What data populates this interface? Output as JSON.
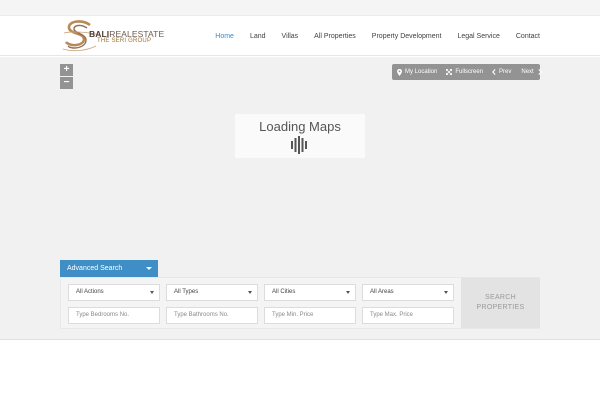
{
  "logo": {
    "brand_prefix": "BALI",
    "brand_suffix": "REALESTATE",
    "tagline": "THE SERI GROUP"
  },
  "nav": {
    "items": [
      {
        "label": "Home",
        "active": true
      },
      {
        "label": "Land",
        "active": false
      },
      {
        "label": "Villas",
        "active": false
      },
      {
        "label": "All Properties",
        "active": false
      },
      {
        "label": "Property Development",
        "active": false
      },
      {
        "label": "Legal Service",
        "active": false
      },
      {
        "label": "Contact",
        "active": false
      }
    ]
  },
  "map": {
    "zoom_in": "+",
    "zoom_out": "−",
    "loading_text": "Loading Maps",
    "toolbar": {
      "my_location": "My Location",
      "fullscreen": "Fullscreen",
      "prev": "Prev",
      "next": "Next"
    }
  },
  "search": {
    "tab_label": "Advanced Search",
    "actions_value": "All Actions",
    "types_value": "All Types",
    "cities_value": "All Cities",
    "areas_value": "All Areas",
    "bedrooms_placeholder": "Type Bedrooms No.",
    "bathrooms_placeholder": "Type Bathrooms No.",
    "min_price_placeholder": "Type Min. Price",
    "max_price_placeholder": "Type Max. Price",
    "button_line1": "SEARCH",
    "button_line2": "PROPERTIES"
  },
  "colors": {
    "accent": "#3f8fc6",
    "nav_active": "#3b8bc8",
    "map_bg": "#f1f1f1",
    "control_bg": "#939393"
  }
}
